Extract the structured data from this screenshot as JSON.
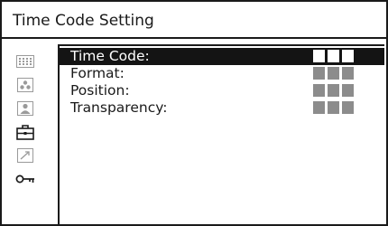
{
  "window": {
    "title": "Time Code Setting"
  },
  "sidebar": {
    "items": [
      {
        "icon": "grid-icon"
      },
      {
        "icon": "color-dots-icon"
      },
      {
        "icon": "person-icon"
      },
      {
        "icon": "toolbox-icon",
        "active": true
      },
      {
        "icon": "arrow-up-right-icon"
      },
      {
        "icon": "key-icon",
        "active": true
      }
    ]
  },
  "menu": {
    "items": [
      {
        "label": "Time Code:",
        "selected": true,
        "value_blocks": 3
      },
      {
        "label": "Format:",
        "selected": false,
        "value_blocks": 3
      },
      {
        "label": "Position:",
        "selected": false,
        "value_blocks": 3
      },
      {
        "label": "Transparency:",
        "selected": false,
        "value_blocks": 3
      }
    ]
  },
  "colors": {
    "highlight": "#141414",
    "inactive_icon": "#9a9a9a",
    "value_placeholder": "#8c8c8c"
  }
}
